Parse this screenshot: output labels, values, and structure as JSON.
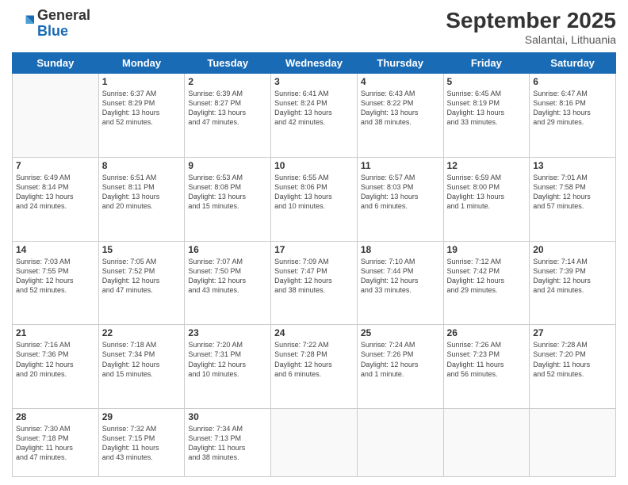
{
  "logo": {
    "general": "General",
    "blue": "Blue"
  },
  "title": "September 2025",
  "location": "Salantai, Lithuania",
  "weekdays": [
    "Sunday",
    "Monday",
    "Tuesday",
    "Wednesday",
    "Thursday",
    "Friday",
    "Saturday"
  ],
  "weeks": [
    [
      {
        "day": "",
        "info": ""
      },
      {
        "day": "1",
        "info": "Sunrise: 6:37 AM\nSunset: 8:29 PM\nDaylight: 13 hours\nand 52 minutes."
      },
      {
        "day": "2",
        "info": "Sunrise: 6:39 AM\nSunset: 8:27 PM\nDaylight: 13 hours\nand 47 minutes."
      },
      {
        "day": "3",
        "info": "Sunrise: 6:41 AM\nSunset: 8:24 PM\nDaylight: 13 hours\nand 42 minutes."
      },
      {
        "day": "4",
        "info": "Sunrise: 6:43 AM\nSunset: 8:22 PM\nDaylight: 13 hours\nand 38 minutes."
      },
      {
        "day": "5",
        "info": "Sunrise: 6:45 AM\nSunset: 8:19 PM\nDaylight: 13 hours\nand 33 minutes."
      },
      {
        "day": "6",
        "info": "Sunrise: 6:47 AM\nSunset: 8:16 PM\nDaylight: 13 hours\nand 29 minutes."
      }
    ],
    [
      {
        "day": "7",
        "info": "Sunrise: 6:49 AM\nSunset: 8:14 PM\nDaylight: 13 hours\nand 24 minutes."
      },
      {
        "day": "8",
        "info": "Sunrise: 6:51 AM\nSunset: 8:11 PM\nDaylight: 13 hours\nand 20 minutes."
      },
      {
        "day": "9",
        "info": "Sunrise: 6:53 AM\nSunset: 8:08 PM\nDaylight: 13 hours\nand 15 minutes."
      },
      {
        "day": "10",
        "info": "Sunrise: 6:55 AM\nSunset: 8:06 PM\nDaylight: 13 hours\nand 10 minutes."
      },
      {
        "day": "11",
        "info": "Sunrise: 6:57 AM\nSunset: 8:03 PM\nDaylight: 13 hours\nand 6 minutes."
      },
      {
        "day": "12",
        "info": "Sunrise: 6:59 AM\nSunset: 8:00 PM\nDaylight: 13 hours\nand 1 minute."
      },
      {
        "day": "13",
        "info": "Sunrise: 7:01 AM\nSunset: 7:58 PM\nDaylight: 12 hours\nand 57 minutes."
      }
    ],
    [
      {
        "day": "14",
        "info": "Sunrise: 7:03 AM\nSunset: 7:55 PM\nDaylight: 12 hours\nand 52 minutes."
      },
      {
        "day": "15",
        "info": "Sunrise: 7:05 AM\nSunset: 7:52 PM\nDaylight: 12 hours\nand 47 minutes."
      },
      {
        "day": "16",
        "info": "Sunrise: 7:07 AM\nSunset: 7:50 PM\nDaylight: 12 hours\nand 43 minutes."
      },
      {
        "day": "17",
        "info": "Sunrise: 7:09 AM\nSunset: 7:47 PM\nDaylight: 12 hours\nand 38 minutes."
      },
      {
        "day": "18",
        "info": "Sunrise: 7:10 AM\nSunset: 7:44 PM\nDaylight: 12 hours\nand 33 minutes."
      },
      {
        "day": "19",
        "info": "Sunrise: 7:12 AM\nSunset: 7:42 PM\nDaylight: 12 hours\nand 29 minutes."
      },
      {
        "day": "20",
        "info": "Sunrise: 7:14 AM\nSunset: 7:39 PM\nDaylight: 12 hours\nand 24 minutes."
      }
    ],
    [
      {
        "day": "21",
        "info": "Sunrise: 7:16 AM\nSunset: 7:36 PM\nDaylight: 12 hours\nand 20 minutes."
      },
      {
        "day": "22",
        "info": "Sunrise: 7:18 AM\nSunset: 7:34 PM\nDaylight: 12 hours\nand 15 minutes."
      },
      {
        "day": "23",
        "info": "Sunrise: 7:20 AM\nSunset: 7:31 PM\nDaylight: 12 hours\nand 10 minutes."
      },
      {
        "day": "24",
        "info": "Sunrise: 7:22 AM\nSunset: 7:28 PM\nDaylight: 12 hours\nand 6 minutes."
      },
      {
        "day": "25",
        "info": "Sunrise: 7:24 AM\nSunset: 7:26 PM\nDaylight: 12 hours\nand 1 minute."
      },
      {
        "day": "26",
        "info": "Sunrise: 7:26 AM\nSunset: 7:23 PM\nDaylight: 11 hours\nand 56 minutes."
      },
      {
        "day": "27",
        "info": "Sunrise: 7:28 AM\nSunset: 7:20 PM\nDaylight: 11 hours\nand 52 minutes."
      }
    ],
    [
      {
        "day": "28",
        "info": "Sunrise: 7:30 AM\nSunset: 7:18 PM\nDaylight: 11 hours\nand 47 minutes."
      },
      {
        "day": "29",
        "info": "Sunrise: 7:32 AM\nSunset: 7:15 PM\nDaylight: 11 hours\nand 43 minutes."
      },
      {
        "day": "30",
        "info": "Sunrise: 7:34 AM\nSunset: 7:13 PM\nDaylight: 11 hours\nand 38 minutes."
      },
      {
        "day": "",
        "info": ""
      },
      {
        "day": "",
        "info": ""
      },
      {
        "day": "",
        "info": ""
      },
      {
        "day": "",
        "info": ""
      }
    ]
  ]
}
